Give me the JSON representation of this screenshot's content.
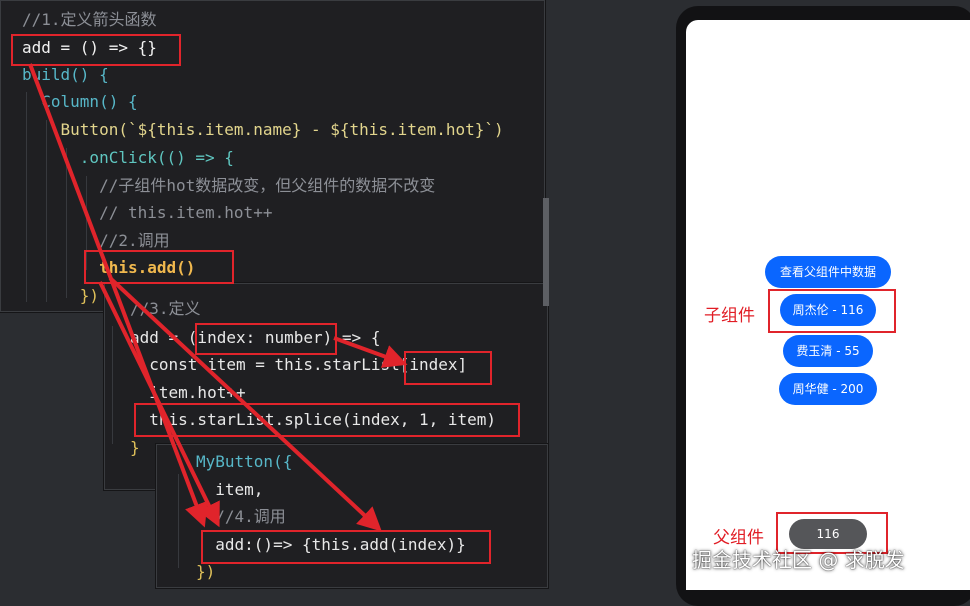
{
  "editor_block_1": {
    "lines": [
      [
        "//1.定义箭头函数",
        "comment"
      ],
      [
        "add = () => {}",
        "plain"
      ],
      [
        "build() {",
        "fn"
      ],
      [
        "  Column() {",
        "fn"
      ],
      [
        "    Button(`${this.item.name} - ${this.item.hot}`)",
        "mixed"
      ],
      [
        "      .onClick(() => {",
        "fn"
      ],
      [
        "        //子组件hot数据改变，但父组件的数据不改变",
        "comment"
      ],
      [
        "        // this.item.hot++",
        "comment"
      ],
      [
        "        //2.调用",
        "comment"
      ],
      [
        "        this.add()",
        "mixed"
      ],
      [
        "      })",
        "punc"
      ]
    ]
  },
  "editor_block_2": {
    "lines": [
      [
        "//3.定义",
        "comment"
      ],
      [
        "add = (index: number) => {",
        "mixed"
      ],
      [
        "  const item = this.starList[index]",
        "mixed"
      ],
      [
        "  item.hot++",
        "plain"
      ],
      [
        "  this.starList.splice(index, 1, item)",
        "mixed"
      ],
      [
        "}",
        "punc"
      ]
    ]
  },
  "editor_block_3": {
    "lines": [
      [
        "MyButton({",
        "fn"
      ],
      [
        "  item,",
        "plain"
      ],
      [
        "  //4.调用",
        "comment"
      ],
      [
        "  add:()=> {this.add(index)}",
        "mixed"
      ],
      [
        "})",
        "punc"
      ]
    ]
  },
  "phone": {
    "view_parent_button": "查看父组件中数据",
    "child_buttons": [
      "周杰伦 - 116",
      "费玉清 - 55",
      "周华健 - 200"
    ],
    "parent_value": "116"
  },
  "labels": {
    "child": "子组件",
    "parent": "父组件"
  },
  "watermark": "掘金技术社区 @ 求脱发",
  "colors": {
    "annotation_red": "#e0242b",
    "button_blue": "#0a66ff",
    "editor_bg": "#1f1f22"
  }
}
